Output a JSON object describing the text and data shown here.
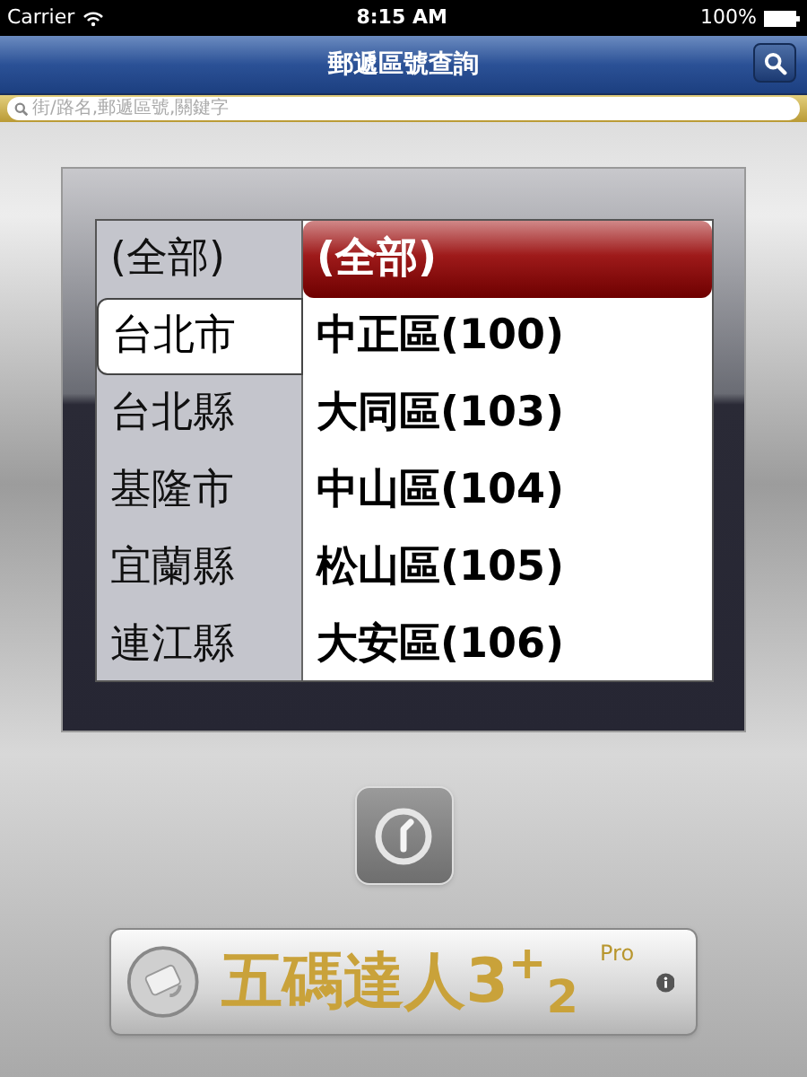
{
  "status_bar": {
    "carrier": "Carrier",
    "time": "8:15 AM",
    "battery": "100%"
  },
  "nav_bar": {
    "title": "郵遞區號查詢"
  },
  "search": {
    "placeholder": "街/路名,郵遞區號,關鍵字"
  },
  "picker": {
    "cities": [
      {
        "label": "(全部)",
        "selected": false
      },
      {
        "label": "台北市",
        "selected": true
      },
      {
        "label": "台北縣",
        "selected": false
      },
      {
        "label": "基隆市",
        "selected": false
      },
      {
        "label": "宜蘭縣",
        "selected": false
      },
      {
        "label": "連江縣",
        "selected": false
      }
    ],
    "districts": [
      {
        "label": "(全部)",
        "selected": true
      },
      {
        "label": "中正區(100)",
        "selected": false
      },
      {
        "label": "大同區(103)",
        "selected": false
      },
      {
        "label": "中山區(104)",
        "selected": false
      },
      {
        "label": "松山區(105)",
        "selected": false
      },
      {
        "label": "大安區(106)",
        "selected": false
      }
    ]
  },
  "banner": {
    "title": "五碼達人3$^{+}$$_{2}$",
    "edition": "Pro"
  }
}
